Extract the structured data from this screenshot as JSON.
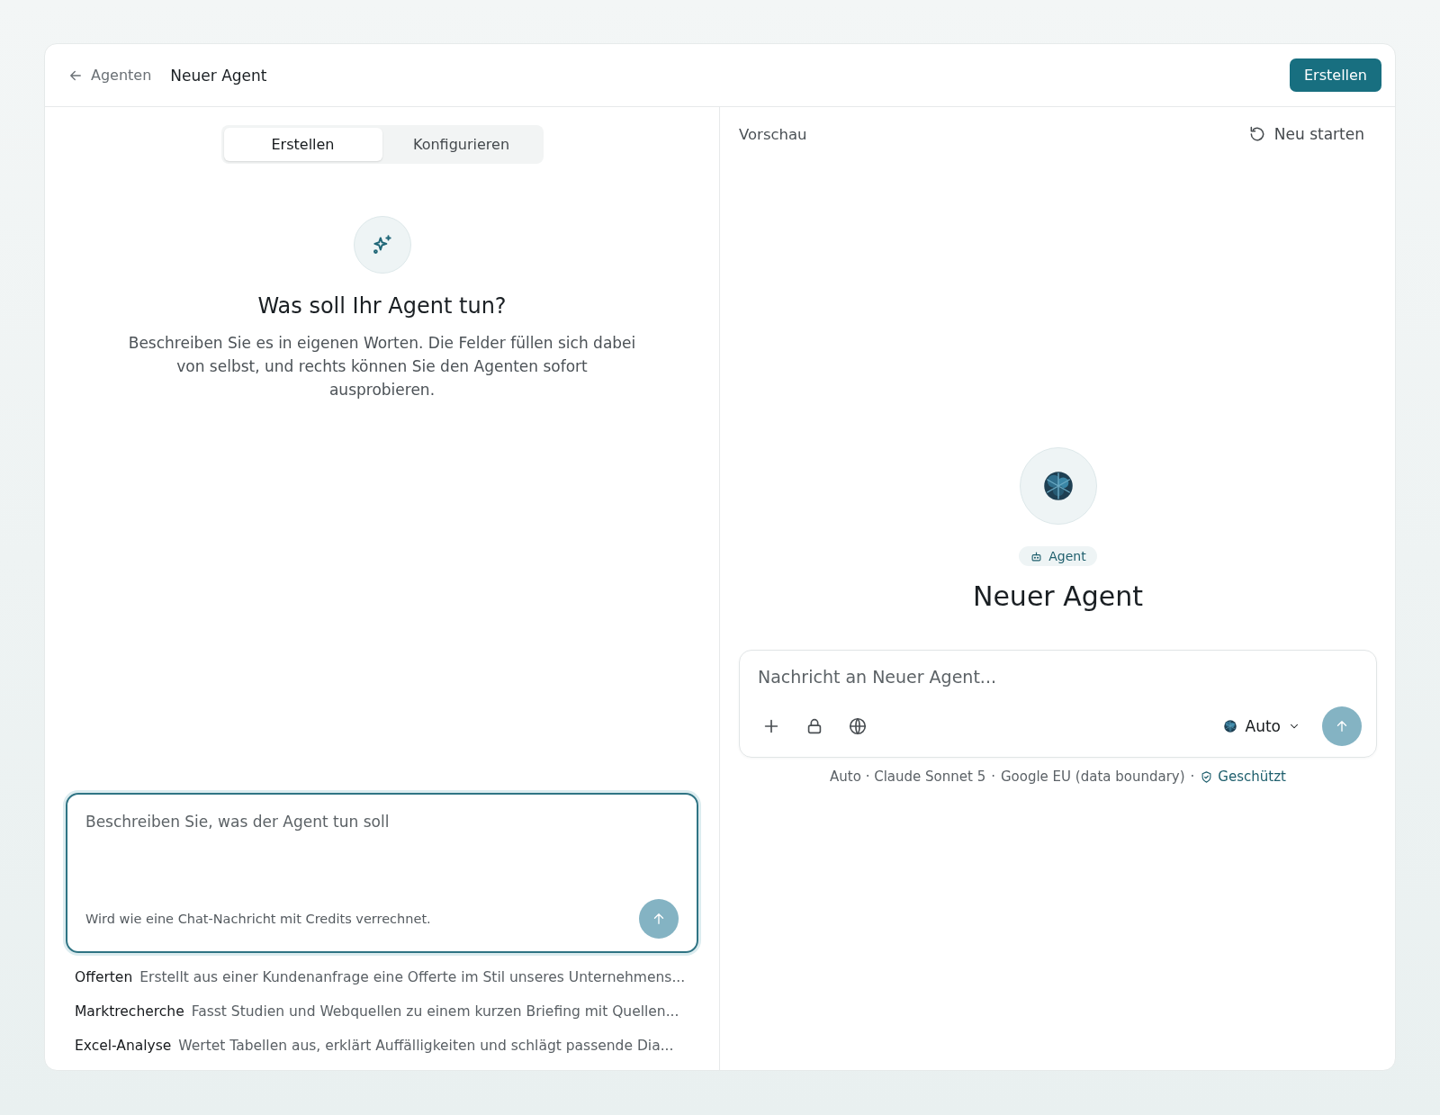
{
  "header": {
    "back_label": "Agenten",
    "title": "Neuer Agent",
    "primary_button": "Erstellen"
  },
  "builder": {
    "tabs": [
      {
        "label": "Erstellen",
        "selected": true
      },
      {
        "label": "Konfigurieren",
        "selected": false
      }
    ],
    "heading": "Was soll Ihr Agent tun?",
    "description": "Beschreiben Sie es in eigenen Worten. Die Felder füllen sich dabei von selbst, und rechts können Sie den Agenten sofort ausprobieren.",
    "input": {
      "placeholder": "Beschreiben Sie, was der Agent tun soll",
      "note": "Wird wie eine Chat-Nachricht mit Credits verrechnet."
    },
    "suggestions": [
      {
        "title": "Offerten",
        "text": "Erstellt aus einer Kundenanfrage eine Offerte im Stil unseres Unternehmens..."
      },
      {
        "title": "Marktrecherche",
        "text": "Fasst Studien und Webquellen zu einem kurzen Briefing mit Quellen..."
      },
      {
        "title": "Excel-Analyse",
        "text": "Wertet Tabellen aus, erklärt Auffälligkeiten und schlägt passende Dia..."
      }
    ]
  },
  "preview": {
    "label": "Vorschau",
    "restart_button": "Neu starten",
    "badge": "Agent",
    "agent_name": "Neuer Agent",
    "chat": {
      "placeholder": "Nachricht an Neuer Agent...",
      "model": "Auto"
    },
    "meta": [
      "Auto · Claude Sonnet 5",
      "Google EU (data boundary)"
    ],
    "separator": "·",
    "protection": "Geschützt"
  }
}
